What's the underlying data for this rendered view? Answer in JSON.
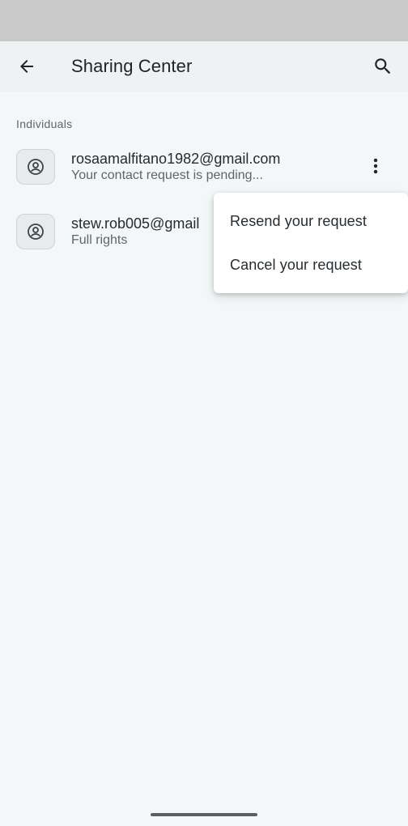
{
  "app_bar": {
    "title": "Sharing Center",
    "back_icon": "arrow-back-icon",
    "search_icon": "search-icon"
  },
  "section": {
    "header": "Individuals"
  },
  "contacts": [
    {
      "email": "rosaamalfitano1982@gmail.com",
      "status": "Your contact request is pending...",
      "avatar_icon": "person-circle-icon",
      "menu_icon": "more-vert-icon"
    },
    {
      "email": "stew.rob005@gmail",
      "status": "Full rights",
      "avatar_icon": "person-circle-icon"
    }
  ],
  "context_menu": {
    "items": [
      {
        "label": "Resend your request"
      },
      {
        "label": "Cancel your request"
      }
    ]
  }
}
